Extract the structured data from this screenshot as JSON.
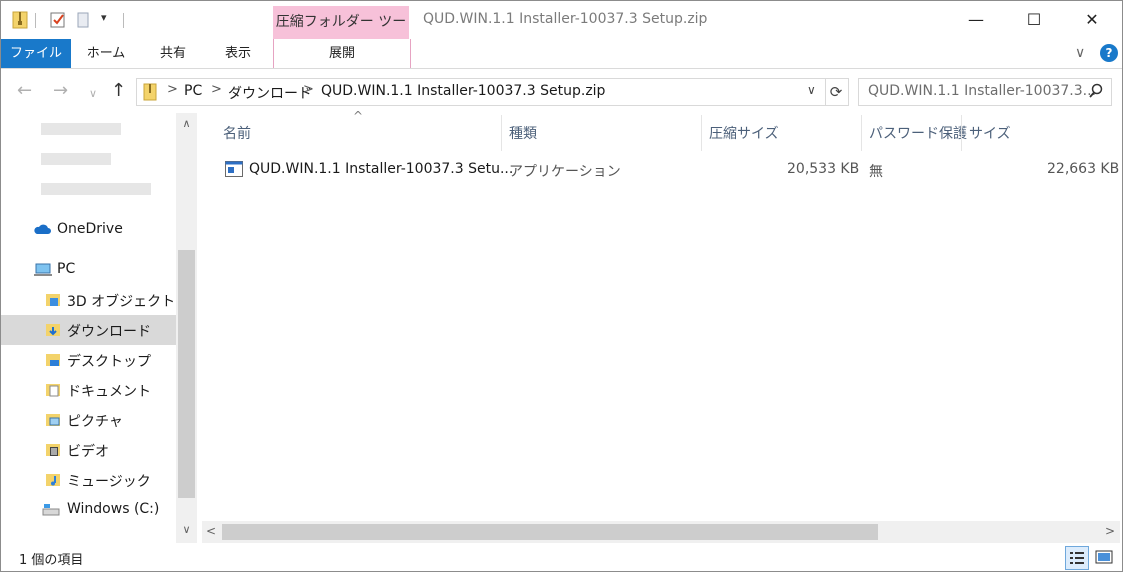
{
  "window": {
    "title": "QUD.WIN.1.1 Installer-10037.3 Setup.zip",
    "context_tab_group": "圧縮フォルダー ツール",
    "caption": {
      "minimize": "—",
      "maximize": "☐",
      "close": "✕"
    }
  },
  "ribbon": {
    "tabs": [
      "ファイル",
      "ホーム",
      "共有",
      "表示"
    ],
    "context_tab": "展開",
    "help": "?",
    "collapse": "∨"
  },
  "nav": {
    "back": "←",
    "forward": "→",
    "recent": "∨",
    "up": "↑",
    "breadcrumb": [
      "PC",
      "ダウンロード",
      "QUD.WIN.1.1 Installer-10037.3 Setup.zip"
    ],
    "search_placeholder": "QUD.WIN.1.1 Installer-10037.3..."
  },
  "sidebar": {
    "onedrive": "OneDrive",
    "pc": "PC",
    "items": [
      {
        "label": "3D オブジェクト",
        "icon": "3d-objects-folder-icon"
      },
      {
        "label": "ダウンロード",
        "icon": "downloads-folder-icon",
        "selected": true
      },
      {
        "label": "デスクトップ",
        "icon": "desktop-folder-icon"
      },
      {
        "label": "ドキュメント",
        "icon": "documents-folder-icon"
      },
      {
        "label": "ピクチャ",
        "icon": "pictures-folder-icon"
      },
      {
        "label": "ビデオ",
        "icon": "videos-folder-icon"
      },
      {
        "label": "ミュージック",
        "icon": "music-folder-icon"
      },
      {
        "label": "Windows (C:)",
        "icon": "drive-icon"
      }
    ]
  },
  "list": {
    "columns": [
      "名前",
      "種類",
      "圧縮サイズ",
      "パスワード保護",
      "サイズ"
    ],
    "sort_indicator": "^",
    "rows": [
      {
        "name": "QUD.WIN.1.1 Installer-10037.3 Setu...",
        "type": "アプリケーション",
        "compressed_size": "20,533 KB",
        "password": "無",
        "size": "22,663 KB"
      }
    ]
  },
  "status": {
    "item_count": "1 個の項目"
  },
  "colors": {
    "file_tab": "#1979ca",
    "context_tab": "#f7c1d9",
    "selected_nav": "#d9d9d9",
    "header_text": "#4c607a"
  }
}
